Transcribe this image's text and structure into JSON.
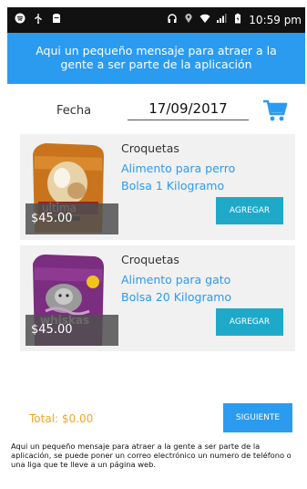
{
  "status_bar": {
    "time": "10:59 pm",
    "icons_left": [
      "spotify-icon",
      "usb-icon",
      "notification-icon"
    ],
    "icons_right": [
      "headphones-icon",
      "location-icon",
      "wifi-icon",
      "signal-icon",
      "battery-icon"
    ]
  },
  "header": {
    "message": "Aqui un pequeño mensaje para atraer a la gente a ser parte de la aplicación"
  },
  "date_row": {
    "label": "Fecha",
    "value": "17/09/2017"
  },
  "products": [
    {
      "name": "Croquetas",
      "line1": "Alimento para perro",
      "line2": "Bolsa  1  Kilogramo",
      "price": "$45.00",
      "button": "AGREGAR",
      "image": "ultima-dog-food-bag"
    },
    {
      "name": "Croquetas",
      "line1": "Alimento para gato",
      "line2": "Bolsa  20  Kilogramo",
      "price": "$45.00",
      "button": "AGREGAR",
      "image": "whiskas-cat-food-bag"
    }
  ],
  "total_label": "Total:  $0.00",
  "next_button": "SIGUIENTE",
  "footer_text": "Aqui un pequeño mensaje para atraer a la gente a ser parte de la aplicación, se puede poner un correo electrónico un numero de teléfono o una liga que te lleve a un página web.",
  "colors": {
    "primary_blue": "#2b9bf0",
    "add_button": "#1fa9c9",
    "total_orange": "#f5a623",
    "card_bg": "#f1f1f1"
  }
}
